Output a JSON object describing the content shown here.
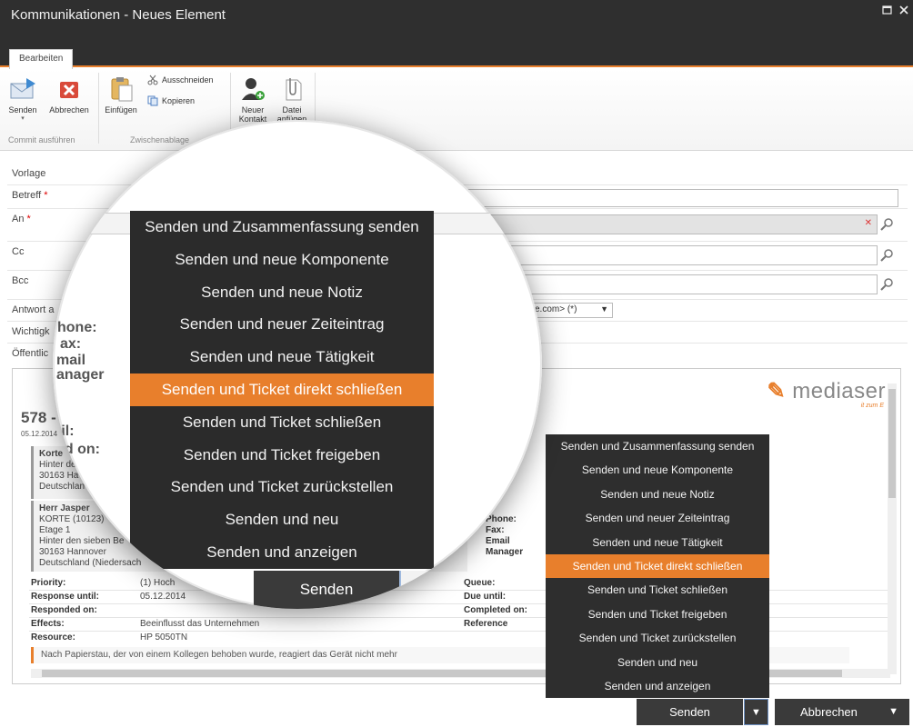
{
  "window": {
    "title": "Kommunikationen - Neues Element",
    "restore_icon": "restore-icon",
    "close_icon": "close-icon"
  },
  "ribbon": {
    "tab": "Bearbeiten",
    "send": "Senden",
    "cancel": "Abbrechen",
    "paste": "Einfügen",
    "cut": "Ausschneiden",
    "copy": "Kopieren",
    "new_contact_line1": "Neuer",
    "new_contact_line2": "Kontakt",
    "attach_line1": "Datei",
    "attach_line2": "anfügen",
    "group_commit": "Commit ausführen",
    "group_clipboard": "Zwischenablage"
  },
  "form": {
    "template_label": "Vorlage",
    "subject_label": "Betreff",
    "to_label": "An",
    "cc_label": "Cc",
    "bcc_label": "Bcc",
    "reply_label": "Antwort a",
    "importance_label": "Wichtigk",
    "public_label": "Öffentlic",
    "required_mark": "*",
    "reply_value": "ce.com> (*)"
  },
  "preview": {
    "ticket_title": "578 -",
    "date": "05.12.2014",
    "logo_text": "mediaser",
    "logo_sub": "it zum E",
    "customer_box": {
      "name": "Korte",
      "line1": "Hinter de",
      "line2": "30163 Ha",
      "line3": "Deutschlan"
    },
    "contact_box": {
      "name": "Herr Jasper",
      "line1": "KORTE (10123)",
      "line2": "Etage 1",
      "line3": "Hinter den sieben Be",
      "line4": "30163 Hannover",
      "line5": "Deutschland (Niedersach"
    },
    "contact_labels": [
      "Phone:",
      "Fax:",
      "Email",
      "Manager"
    ],
    "fields_left": [
      {
        "label": "Priority:",
        "value": "(1) Hoch"
      },
      {
        "label": "Response until:",
        "value": "05.12.2014"
      },
      {
        "label": "Responded on:",
        "value": ""
      },
      {
        "label": "Effects:",
        "value": "Beeinflusst das Unternehmen"
      },
      {
        "label": "Resource:",
        "value": "HP 5050TN"
      }
    ],
    "fields_right": [
      {
        "label": "Queue:"
      },
      {
        "label": "Due until:"
      },
      {
        "label": "Completed on:"
      },
      {
        "label": "Reference"
      }
    ],
    "note": "Nach Papierstau, der von einem Kollegen behoben wurde, reagiert das Gerät nicht mehr"
  },
  "magnifier": {
    "bg_labels": [
      "hone:",
      "ax:",
      "mail",
      "anager",
      "til:",
      "ed on:"
    ],
    "send_button": "Senden"
  },
  "send_menu": {
    "items": [
      "Senden und Zusammenfassung senden",
      "Senden und neue Komponente",
      "Senden und neue Notiz",
      "Senden und neuer Zeiteintrag",
      "Senden und neue Tätigkeit",
      "Senden und Ticket direkt schließen",
      "Senden und Ticket schließen",
      "Senden und Ticket freigeben",
      "Senden und Ticket zurückstellen",
      "Senden und neu",
      "Senden und anzeigen"
    ],
    "active_index": 5
  },
  "footer": {
    "send": "Senden",
    "cancel": "Abbrechen",
    "caret": "▼"
  },
  "colors": {
    "accent": "#e87f2c",
    "dark": "#2e2e2e"
  }
}
